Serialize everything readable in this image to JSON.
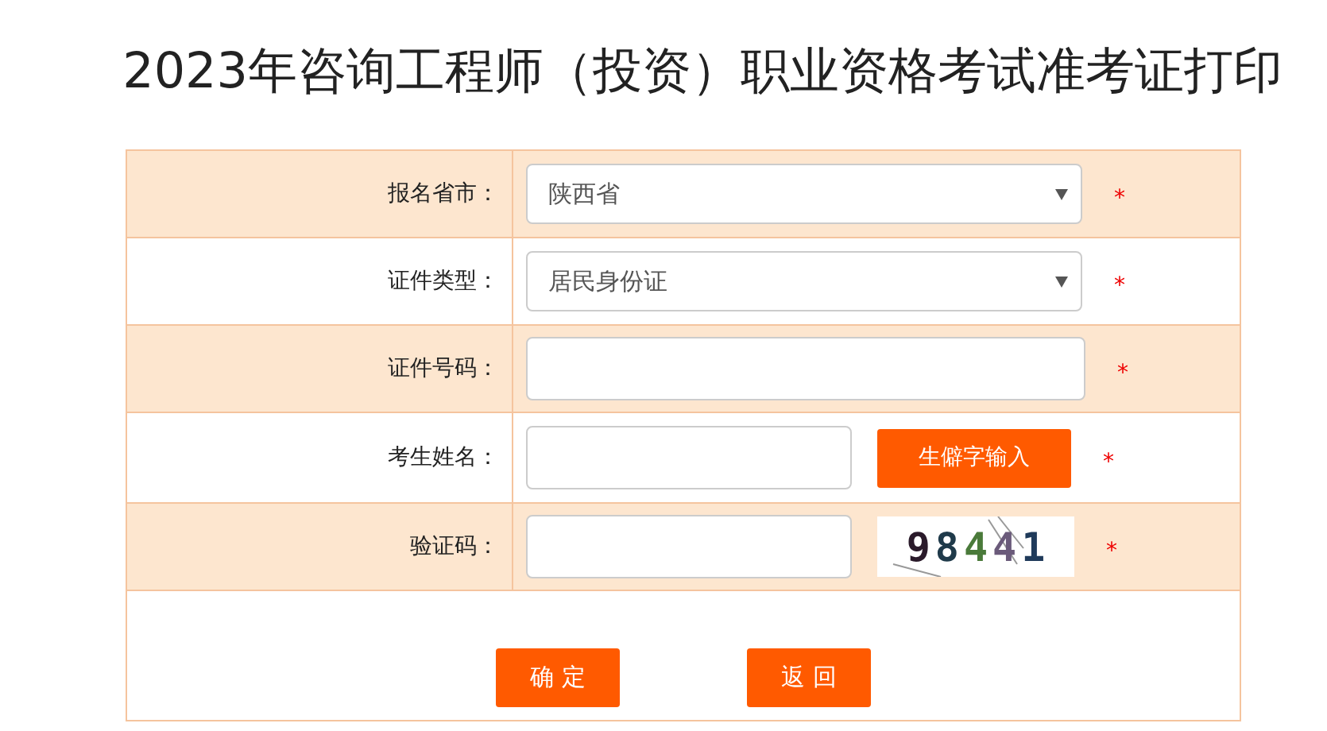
{
  "title": "2023年咨询工程师（投资）职业资格考试准考证打印",
  "form": {
    "rows": [
      {
        "kind": "select",
        "label": "报名省市：",
        "value": "陕西省",
        "required_mark": "*"
      },
      {
        "kind": "select",
        "label": "证件类型：",
        "value": "居民身份证",
        "required_mark": "*"
      },
      {
        "kind": "text",
        "label": "证件号码：",
        "required_mark": "*"
      },
      {
        "kind": "text_button",
        "label": "考生姓名：",
        "button": "生僻字输入",
        "required_mark": "*"
      },
      {
        "kind": "captcha",
        "label": "验证码：",
        "captcha": "98441",
        "required_mark": "*"
      }
    ]
  },
  "buttons": [
    "确 定",
    "返 回"
  ]
}
